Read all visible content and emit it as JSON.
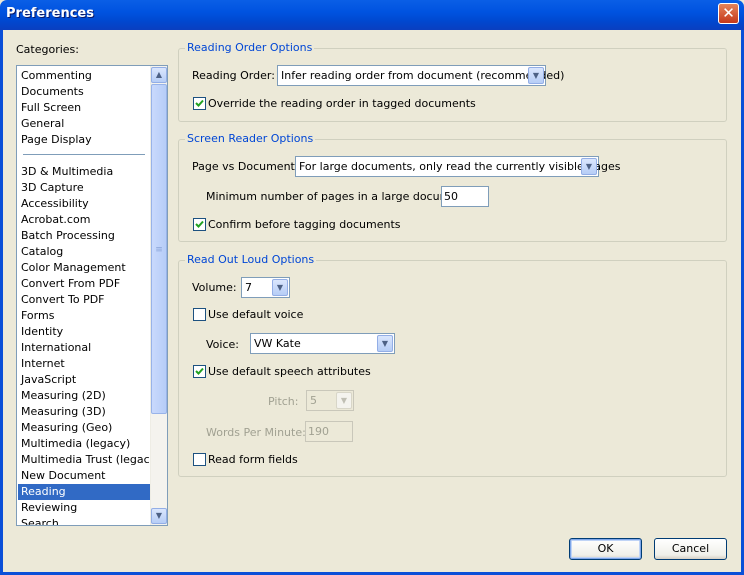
{
  "window": {
    "title": "Preferences"
  },
  "categories": {
    "label": "Categories:",
    "group1": [
      "Commenting",
      "Documents",
      "Full Screen",
      "General",
      "Page Display"
    ],
    "group2": [
      "3D & Multimedia",
      "3D Capture",
      "Accessibility",
      "Acrobat.com",
      "Batch Processing",
      "Catalog",
      "Color Management",
      "Convert From PDF",
      "Convert To PDF",
      "Forms",
      "Identity",
      "International",
      "Internet",
      "JavaScript",
      "Measuring (2D)",
      "Measuring (3D)",
      "Measuring (Geo)",
      "Multimedia (legacy)",
      "Multimedia Trust (legacy)",
      "New Document",
      "Reading",
      "Reviewing",
      "Search"
    ],
    "selected": "Reading"
  },
  "reading_order": {
    "title": "Reading Order Options",
    "order_label": "Reading Order:",
    "order_value": "Infer reading order from document (recommended)",
    "override_label": "Override the reading order in tagged documents",
    "override_checked": true
  },
  "screen_reader": {
    "title": "Screen Reader Options",
    "page_vs_doc_label": "Page vs Document:",
    "page_vs_doc_value": "For large documents, only read the currently visible pages",
    "min_pages_label": "Minimum number of pages in a large document:",
    "min_pages_value": "50",
    "confirm_label": "Confirm before tagging documents",
    "confirm_checked": true
  },
  "read_out_loud": {
    "title": "Read Out Loud Options",
    "volume_label": "Volume:",
    "volume_value": "7",
    "default_voice_label": "Use default voice",
    "default_voice_checked": false,
    "voice_label": "Voice:",
    "voice_value": "VW Kate",
    "default_speech_label": "Use default speech attributes",
    "default_speech_checked": true,
    "pitch_label": "Pitch:",
    "pitch_value": "5",
    "wpm_label": "Words Per Minute:",
    "wpm_value": "190",
    "read_form_label": "Read form fields",
    "read_form_checked": false
  },
  "buttons": {
    "ok": "OK",
    "cancel": "Cancel"
  },
  "colors": {
    "accent": "#0046d5",
    "selection": "#316ac5",
    "titlebar": "#0053e0",
    "dialog_bg": "#ece9d8"
  },
  "icons": {
    "close": "close-icon",
    "check": "check-icon",
    "dropdown": "chevron-down-icon"
  }
}
